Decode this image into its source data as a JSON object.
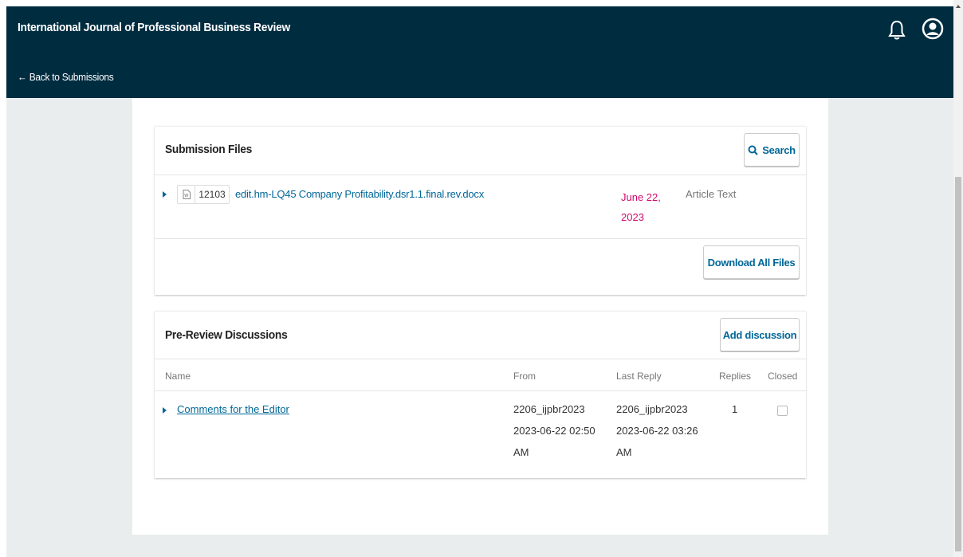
{
  "header": {
    "journal_title": "International Journal of Professional Business Review",
    "back_label": "← Back to Submissions"
  },
  "files_panel": {
    "title": "Submission Files",
    "search_label": "Search",
    "download_all_label": "Download All Files",
    "file": {
      "id": "12103",
      "name": "edit.hm-LQ45 Company Profitability.dsr1.1.final.rev.docx",
      "date_line1": "June 22,",
      "date_line2": "2023",
      "type": "Article Text"
    }
  },
  "discussions_panel": {
    "title": "Pre-Review Discussions",
    "add_label": "Add discussion",
    "columns": {
      "name": "Name",
      "from": "From",
      "last_reply": "Last Reply",
      "replies": "Replies",
      "closed": "Closed"
    },
    "row": {
      "name": "Comments for the Editor",
      "from_user": "2206_ijpbr2023",
      "from_date": "2023-06-22 02:50",
      "from_ampm": "AM",
      "reply_user": "2206_ijpbr2023",
      "reply_date": "2023-06-22 03:26",
      "reply_ampm": "AM",
      "replies": "1"
    }
  },
  "colors": {
    "header_bg": "#002c40",
    "link": "#006798",
    "date_accent": "#d00a6c"
  }
}
